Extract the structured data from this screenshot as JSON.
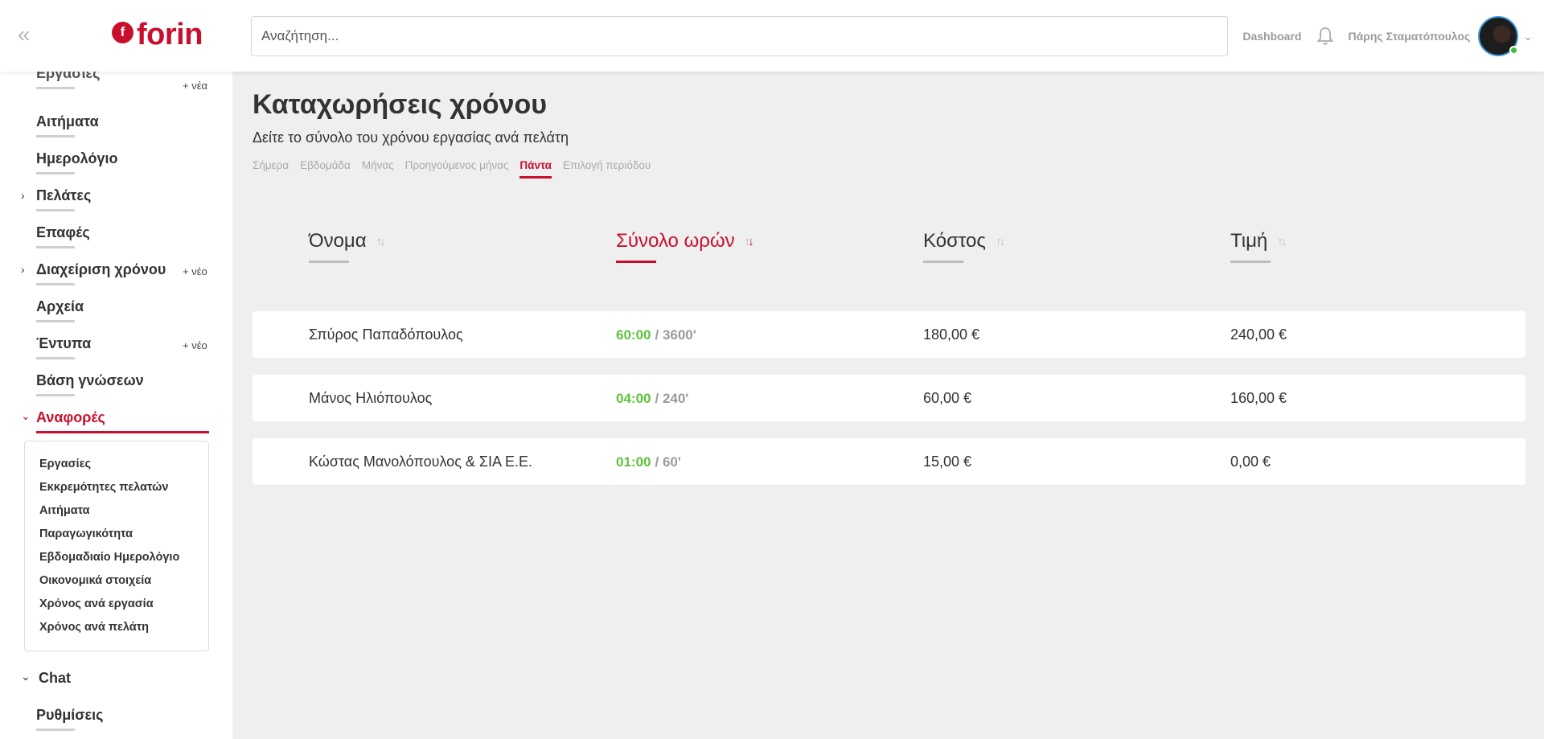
{
  "brand": {
    "name": "forin",
    "mark": "f"
  },
  "header": {
    "search_placeholder": "Αναζήτηση...",
    "dashboard_label": "Dashboard",
    "user_name": "Πάρης Σταματόπουλος"
  },
  "sidebar": {
    "partial_top_label": "Εργασίες",
    "partial_top_new": "+ νέα",
    "items": [
      {
        "label": "Αιτήματα"
      },
      {
        "label": "Ημερολόγιο"
      },
      {
        "label": "Πελάτες"
      },
      {
        "label": "Επαφές"
      },
      {
        "label": "Διαχείριση χρόνου",
        "new": "+ νέο"
      },
      {
        "label": "Αρχεία"
      },
      {
        "label": "Έντυπα",
        "new": "+ νέο"
      },
      {
        "label": "Βάση γνώσεων"
      },
      {
        "label": "Αναφορές"
      },
      {
        "label": "Chat"
      },
      {
        "label": "Ρυθμίσεις"
      }
    ],
    "reports_submenu": [
      "Εργασίες",
      "Εκκρεμότητες πελατών",
      "Αιτήματα",
      "Παραγωγικότητα",
      "Εβδομαδιαίο Ημερολόγιο",
      "Οικονομικά στοιχεία",
      "Χρόνος ανά εργασία",
      "Χρόνος ανά πελάτη"
    ]
  },
  "main": {
    "title": "Καταχωρήσεις χρόνου",
    "subtitle": "Δείτε το σύνολο του χρόνου εργασίας ανά πελάτη",
    "tabs": [
      "Σήμερα",
      "Εβδομάδα",
      "Μήνας",
      "Προηγούμενος μήνας",
      "Πάντα",
      "Επιλογή περιόδου"
    ],
    "active_tab": "Πάντα",
    "columns": [
      "Όνομα",
      "Σύνολο ωρών",
      "Κόστος",
      "Τιμή"
    ],
    "sorted_column": "Σύνολο ωρών",
    "rows": [
      {
        "name": "Σπύρος Παπαδόπουλος",
        "hours": "60:00",
        "minutes": "/ 3600'",
        "cost": "180,00 €",
        "price": "240,00 €"
      },
      {
        "name": "Μάνος Ηλιόπουλος",
        "hours": "04:00",
        "minutes": "/ 240'",
        "cost": "60,00 €",
        "price": "160,00 €"
      },
      {
        "name": "Κώστας Μανολόπουλος & ΣΙΑ Ε.Ε.",
        "hours": "01:00",
        "minutes": "/ 60'",
        "cost": "15,00 €",
        "price": "0,00 €"
      }
    ]
  },
  "colors": {
    "brand": "#c8102e",
    "hours_green": "#5cc43a",
    "online": "#3dbb3d"
  }
}
